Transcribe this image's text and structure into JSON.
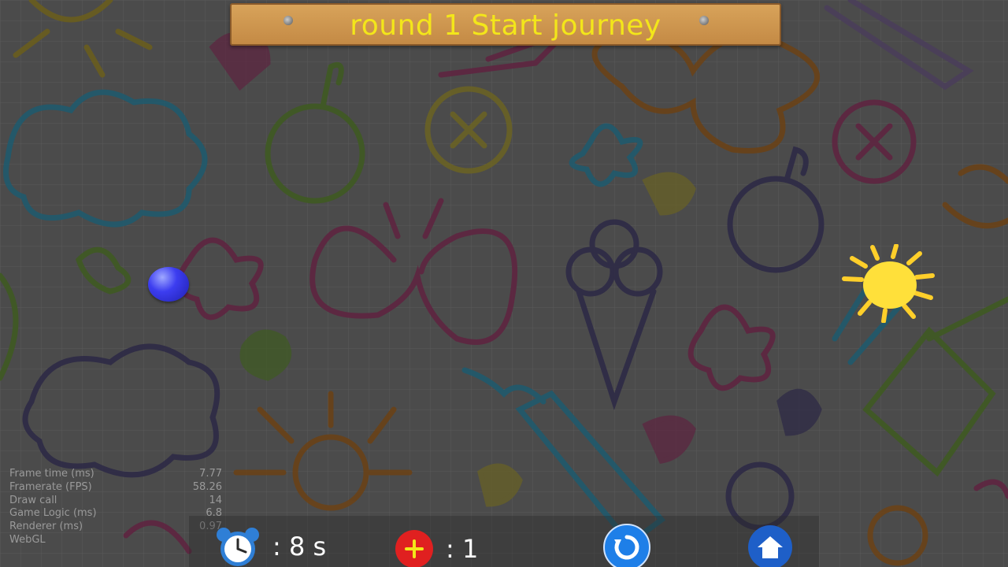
{
  "title": "round 1 Start journey",
  "stats": [
    {
      "label": "Frame time (ms)",
      "value": "7.77"
    },
    {
      "label": "Framerate (FPS)",
      "value": "58.26"
    },
    {
      "label": "Draw call",
      "value": "14"
    },
    {
      "label": "Game Logic (ms)",
      "value": "6.8"
    },
    {
      "label": "Renderer (ms)",
      "value": "0.97"
    },
    {
      "label": "WebGL",
      "value": ""
    }
  ],
  "hud": {
    "timer": ": 8 s",
    "bonus": ": 1"
  },
  "icons": {
    "timer": "alarm-clock-icon",
    "bonus": "plus-icon",
    "restart": "restart-icon",
    "home": "home-icon",
    "player": "blue-ball",
    "goal": "yellow-sun"
  },
  "colors": {
    "title": "#f3e61a",
    "player": "#3c3df0",
    "goal": "#ffe03a",
    "bonus": "#e02020",
    "button": "#1e7fe8"
  }
}
